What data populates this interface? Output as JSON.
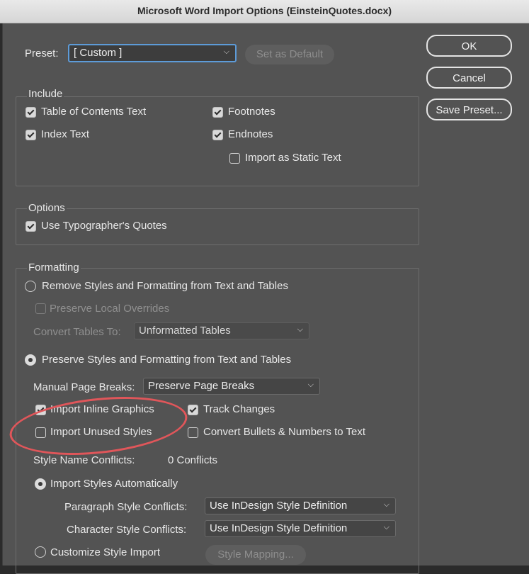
{
  "window": {
    "title": "Microsoft Word Import Options (EinsteinQuotes.docx)"
  },
  "buttons": {
    "ok": "OK",
    "cancel": "Cancel",
    "save_preset": "Save Preset...",
    "set_as_default": "Set as Default"
  },
  "preset": {
    "label": "Preset:",
    "value": "[ Custom ]"
  },
  "include": {
    "title": "Include",
    "items": [
      {
        "label": "Table of Contents Text",
        "checked": true
      },
      {
        "label": "Footnotes",
        "checked": true
      },
      {
        "label": "Index Text",
        "checked": true
      },
      {
        "label": "Endnotes",
        "checked": true
      },
      {
        "label": "Import as Static Text",
        "checked": false
      }
    ]
  },
  "options": {
    "title": "Options",
    "use_typographers_quotes": {
      "label": "Use Typographer's Quotes",
      "checked": true
    }
  },
  "formatting": {
    "title": "Formatting",
    "remove_styles": {
      "label": "Remove Styles and Formatting from Text and Tables",
      "selected": false
    },
    "preserve_local_overrides": {
      "label": "Preserve Local Overrides",
      "checked": false
    },
    "convert_tables": {
      "label": "Convert Tables To:",
      "value": "Unformatted Tables"
    },
    "preserve_styles": {
      "label": "Preserve Styles and Formatting from Text and Tables",
      "selected": true
    },
    "manual_page_breaks": {
      "label": "Manual Page Breaks:",
      "value": "Preserve Page Breaks"
    },
    "import_inline_graphics": {
      "label": "Import Inline Graphics",
      "checked": true
    },
    "track_changes": {
      "label": "Track Changes",
      "checked": true
    },
    "import_unused_styles": {
      "label": "Import Unused Styles",
      "checked": false
    },
    "convert_bullets": {
      "label": "Convert Bullets & Numbers to Text",
      "checked": false
    },
    "style_name_conflicts": {
      "label": "Style Name Conflicts:",
      "value": "0 Conflicts"
    },
    "import_styles_automatically": {
      "label": "Import Styles Automatically",
      "selected": true
    },
    "paragraph_style_conflicts": {
      "label": "Paragraph Style Conflicts:",
      "value": "Use InDesign Style Definition"
    },
    "character_style_conflicts": {
      "label": "Character Style Conflicts:",
      "value": "Use InDesign Style Definition"
    },
    "customize_style_import": {
      "label": "Customize Style Import",
      "selected": false
    },
    "style_mapping_button": "Style Mapping..."
  },
  "icons": {
    "chevron": "chevron-down-icon"
  },
  "colors": {
    "annotation_circle": "#e0565a",
    "focus_ring": "#5d9bd8",
    "dialog_bg": "#535353"
  }
}
